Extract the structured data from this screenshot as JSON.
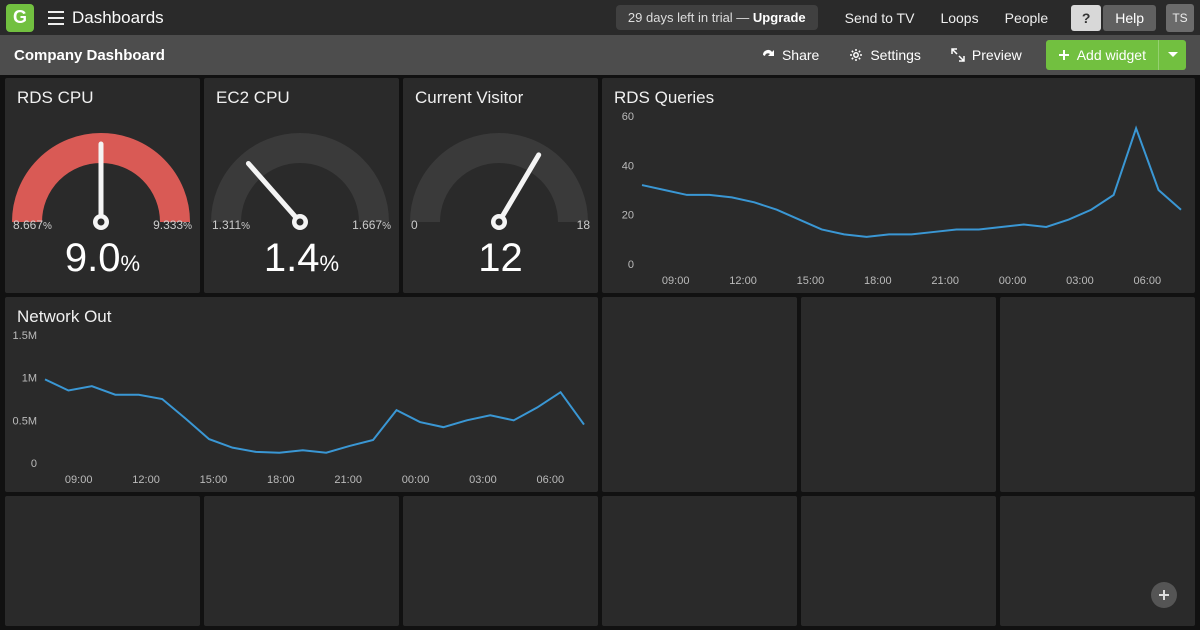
{
  "nav": {
    "logo": "G",
    "title": "Dashboards",
    "trial_prefix": "29 days left in trial — ",
    "trial_upgrade": "Upgrade",
    "links": {
      "tv": "Send to TV",
      "loops": "Loops",
      "people": "People"
    },
    "question": "?",
    "help": "Help",
    "avatar": "TS"
  },
  "subbar": {
    "title": "Company Dashboard",
    "share": "Share",
    "settings": "Settings",
    "preview": "Preview",
    "add": "Add widget"
  },
  "widgets": {
    "rds_cpu": {
      "title": "RDS CPU",
      "min": "8.667",
      "max": "9.333",
      "value": "9.0",
      "unit": "%",
      "fill_color": "#d95a55",
      "fill_frac": 1.0,
      "needle_frac": 0.5
    },
    "ec2_cpu": {
      "title": "EC2 CPU",
      "min": "1.311",
      "max": "1.667",
      "value": "1.4",
      "unit": "%",
      "fill_color": "#555",
      "fill_frac": 0.0,
      "needle_frac": 0.27
    },
    "visitors": {
      "title": "Current Visitor",
      "min": "0",
      "max": "18",
      "value": "12",
      "unit": "",
      "fill_color": "#555",
      "fill_frac": 0.0,
      "needle_frac": 0.67
    },
    "rds_q": {
      "title": "RDS Queries"
    },
    "net_out": {
      "title": "Network Out"
    }
  },
  "chart_data": [
    {
      "id": "rds_queries",
      "type": "line",
      "title": "RDS Queries",
      "xlabel": "",
      "ylabel": "",
      "ylim": [
        0,
        60
      ],
      "y_ticks": [
        0,
        20,
        40,
        60
      ],
      "x_ticks": [
        "09:00",
        "12:00",
        "15:00",
        "18:00",
        "21:00",
        "00:00",
        "03:00",
        "06:00"
      ],
      "series": [
        {
          "name": "queries",
          "x": [
            "08:00",
            "09:00",
            "10:00",
            "11:00",
            "12:00",
            "13:00",
            "14:00",
            "15:00",
            "16:00",
            "17:00",
            "18:00",
            "19:00",
            "20:00",
            "21:00",
            "22:00",
            "23:00",
            "00:00",
            "01:00",
            "02:00",
            "03:00",
            "04:00",
            "05:00",
            "05:30",
            "06:00",
            "07:00"
          ],
          "values": [
            32,
            30,
            28,
            28,
            27,
            25,
            22,
            18,
            14,
            12,
            11,
            12,
            12,
            13,
            14,
            14,
            15,
            16,
            15,
            18,
            22,
            28,
            55,
            30,
            22
          ]
        }
      ]
    },
    {
      "id": "network_out",
      "type": "line",
      "title": "Network Out",
      "xlabel": "",
      "ylabel": "",
      "ylim": [
        0,
        1500000
      ],
      "y_ticks": [
        0,
        500000,
        1000000,
        1500000
      ],
      "y_tick_labels": [
        "0",
        "0.5M",
        "1M",
        "1.5M"
      ],
      "x_ticks": [
        "09:00",
        "12:00",
        "15:00",
        "18:00",
        "21:00",
        "00:00",
        "03:00",
        "06:00"
      ],
      "series": [
        {
          "name": "bytes",
          "x": [
            "08:00",
            "09:00",
            "10:00",
            "11:00",
            "12:00",
            "13:00",
            "14:00",
            "15:00",
            "16:00",
            "17:00",
            "18:00",
            "19:00",
            "20:00",
            "21:00",
            "22:00",
            "23:00",
            "00:00",
            "01:00",
            "02:00",
            "03:00",
            "04:00",
            "05:00",
            "06:00",
            "07:00"
          ],
          "values": [
            980000,
            850000,
            900000,
            800000,
            800000,
            750000,
            520000,
            280000,
            180000,
            130000,
            120000,
            150000,
            120000,
            200000,
            270000,
            620000,
            480000,
            420000,
            500000,
            560000,
            500000,
            650000,
            830000,
            450000
          ]
        }
      ]
    }
  ],
  "colors": {
    "accent": "#72c040",
    "line": "#3a97d4"
  }
}
